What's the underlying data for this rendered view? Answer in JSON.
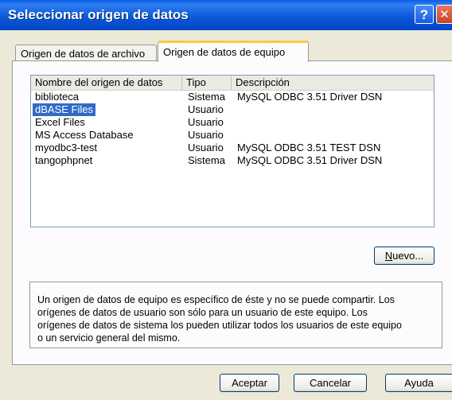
{
  "window": {
    "title": "Seleccionar origen de datos",
    "help_symbol": "?",
    "close_symbol": "✕"
  },
  "tabs": [
    {
      "label": "Origen de datos de archivo",
      "active": false
    },
    {
      "label": "Origen de datos de equipo",
      "active": true
    }
  ],
  "list": {
    "columns": [
      "Nombre del origen de datos",
      "Tipo",
      "Descripción"
    ],
    "rows": [
      {
        "name": "biblioteca",
        "type": "Sistema",
        "description": "MySQL ODBC 3.51 Driver DSN"
      },
      {
        "name": "dBASE Files",
        "type": "Usuario",
        "description": ""
      },
      {
        "name": "Excel Files",
        "type": "Usuario",
        "description": ""
      },
      {
        "name": "MS Access Database",
        "type": "Usuario",
        "description": ""
      },
      {
        "name": "myodbc3-test",
        "type": "Usuario",
        "description": "MySQL ODBC 3.51 TEST DSN"
      },
      {
        "name": "tangophpnet",
        "type": "Sistema",
        "description": "MySQL ODBC 3.51 Driver DSN"
      }
    ],
    "selected_row": "dBASE Files"
  },
  "buttons": {
    "nuevo": {
      "prefix": "",
      "underlined": "N",
      "suffix": "uevo..."
    },
    "aceptar": "Aceptar",
    "cancelar": "Cancelar",
    "ayuda": "Ayuda"
  },
  "info_text": {
    "line1": "Un origen de datos de equipo es específico de éste y no se puede compartir. Los",
    "line2": "orígenes de datos de usuario son sólo para un usuario de este equipo. Los",
    "line3": "orígenes de datos de sistema los pueden utilizar todos los usuarios de este equipo",
    "line4": "o un servicio general del mismo."
  },
  "colors": {
    "titlebar": "#0A5EE8",
    "selection": "#316AC5",
    "active_tab_accent": "#FFC83C",
    "dialog_background": "#ECE9D8"
  }
}
